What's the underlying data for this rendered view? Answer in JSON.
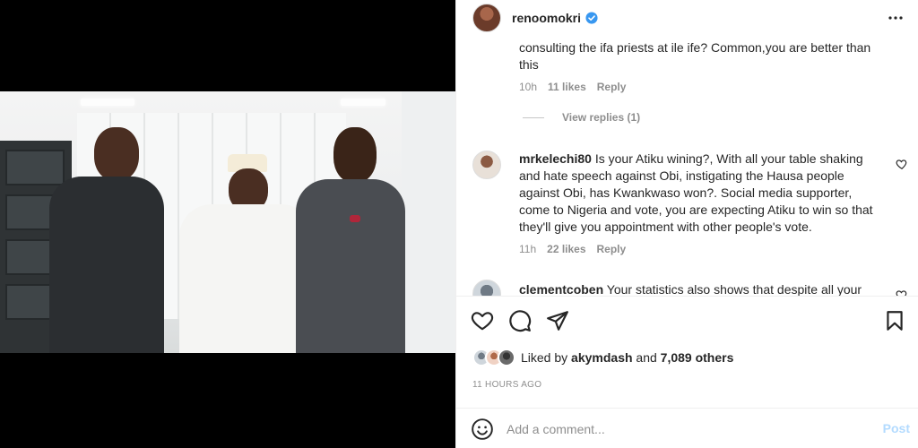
{
  "post": {
    "username": "renoomokri",
    "verified": true,
    "liked_by_user": "akymdash",
    "liked_by_and": "and",
    "liked_by_others": "7,089 others",
    "liked_by_prefix": "Liked by",
    "time_ago": "11 HOURS AGO"
  },
  "comments": [
    {
      "text": "consulting the ifa priests at ile ife? Common,you are better than this",
      "time": "10h",
      "likes": "11 likes",
      "reply_label": "Reply",
      "view_replies": "View replies (1)"
    },
    {
      "user": "mrkelechi80",
      "text": "Is your Atiku wining?, With all your table shaking and hate speech against Obi, instigating the Hausa people against Obi, has Kwankwaso won?. Social media supporter, come to Nigeria and vote, you are expecting Atiku to win so that they'll give you appointment with other people's vote.",
      "time": "11h",
      "likes": "22 likes",
      "reply_label": "Reply"
    },
    {
      "user": "clementcoben",
      "text": "Your statistics also shows that despite all your"
    }
  ],
  "add_comment": {
    "placeholder": "Add a comment...",
    "post_label": "Post"
  },
  "colors": {
    "verified": "#3897f0",
    "post_button": "#b3dbff",
    "muted_text": "#8e8e8e"
  },
  "icons": [
    "more-icon",
    "verified-icon",
    "heart-icon",
    "comment-icon",
    "share-icon",
    "bookmark-icon",
    "emoji-icon"
  ]
}
